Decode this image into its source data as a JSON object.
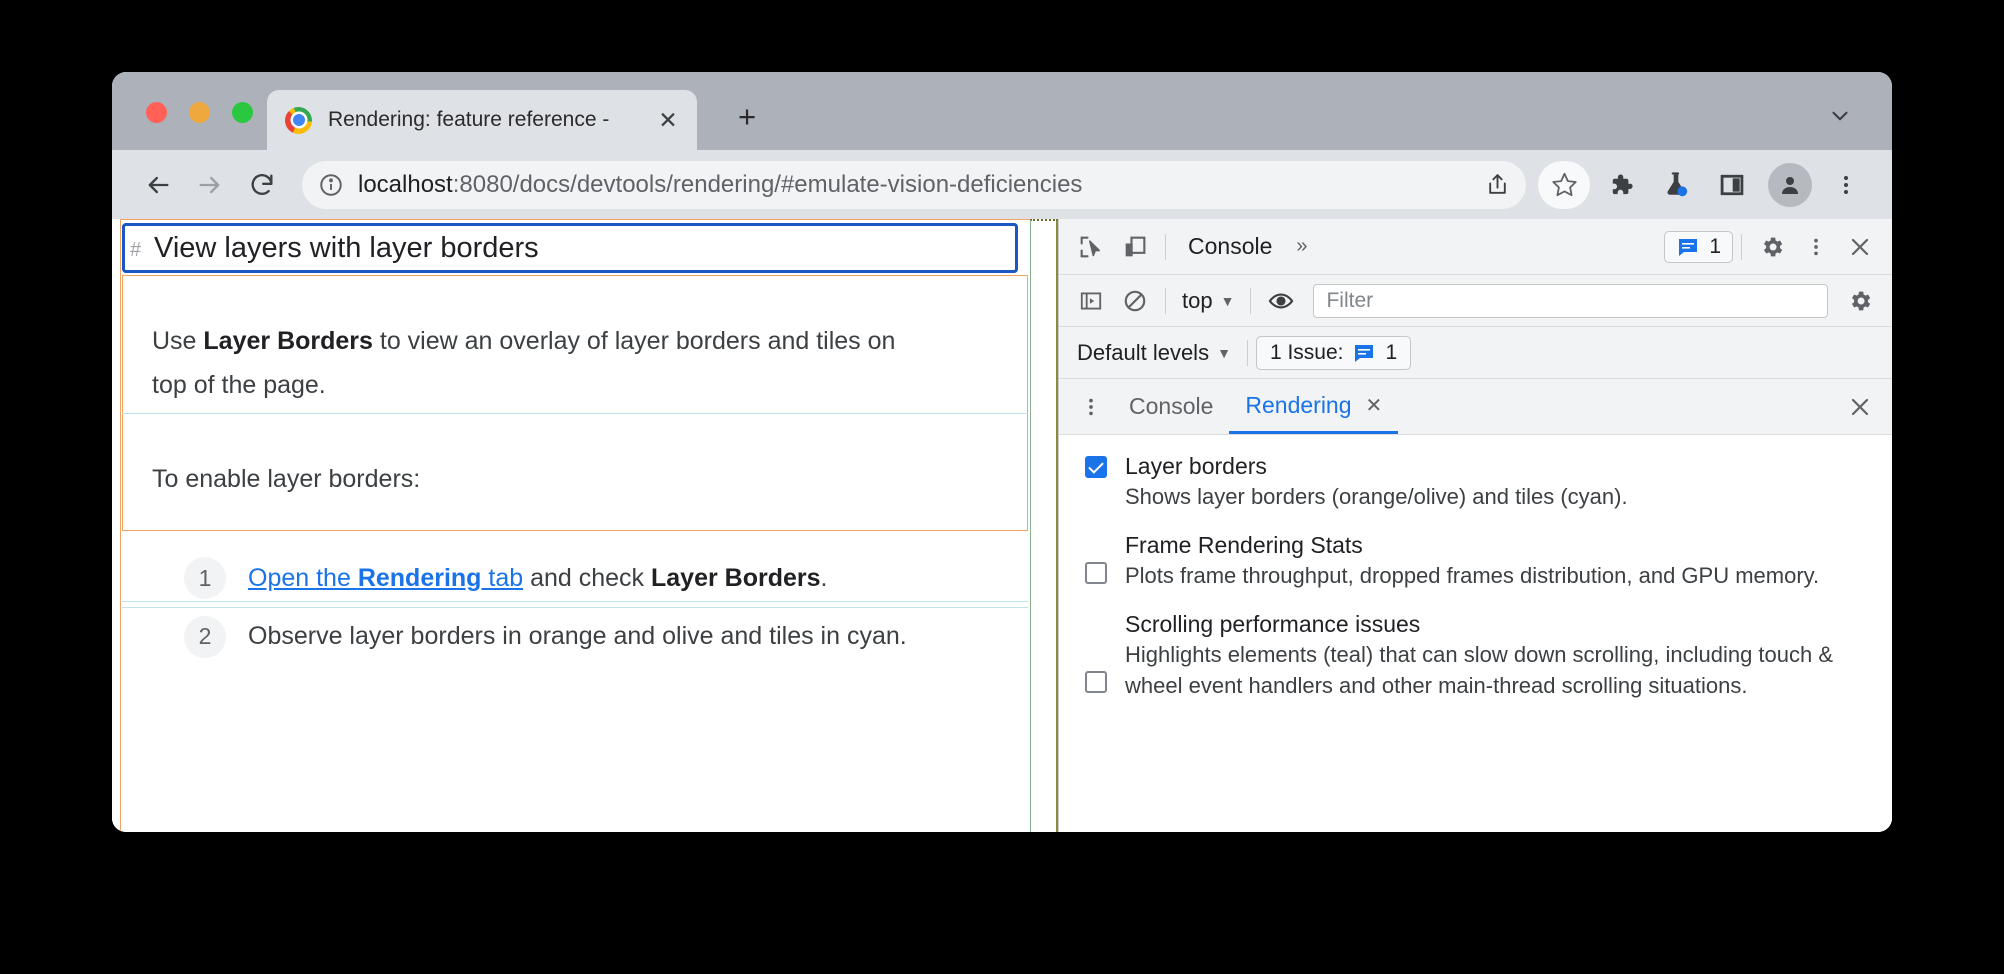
{
  "browser": {
    "tab": {
      "title": "Rendering: feature reference - ",
      "close_label": "✕"
    },
    "newtab_label": "+",
    "omnibox": {
      "url_host": "localhost",
      "url_rest": ":8080/docs/devtools/rendering/#emulate-vision-deficiencies"
    },
    "icons": {
      "back": "back-arrow-icon",
      "forward": "forward-arrow-icon",
      "reload": "reload-icon",
      "site_info": "info-circle-icon",
      "share": "share-icon",
      "bookmark": "star-icon",
      "extensions": "puzzle-piece-icon",
      "experiments": "flask-icon",
      "side_panel": "side-panel-icon",
      "profile": "avatar-icon",
      "menu": "three-dot-menu-icon",
      "tab_list": "chevron-down-icon"
    }
  },
  "page": {
    "anchor": "#",
    "heading": "View layers with layer borders",
    "paragraph1_pre": "Use ",
    "paragraph1_bold": "Layer Borders",
    "paragraph1_post": " to view an overlay of layer borders and tiles on",
    "paragraph1_line2": "top of the page.",
    "paragraph2": "To enable layer borders:",
    "steps": [
      {
        "num": "1",
        "link_pre": "Open the ",
        "link_bold": "Rendering",
        "link_post": " tab",
        "mid": " and check ",
        "bold": "Layer Borders",
        "end": "."
      },
      {
        "num": "2",
        "text": "Observe layer borders in orange and olive and tiles in cyan."
      }
    ],
    "overlay_colors": {
      "layer_border_orange": "#f4a460",
      "layer_border_olive": "#8a8a45",
      "tile_cyan": "#bfe3e8",
      "selected_layer_blue": "#1a56c4"
    }
  },
  "devtools": {
    "main_toolbar": {
      "inspect_icon": "inspect-cursor-icon",
      "device_icon": "device-toolbar-icon",
      "active_tab": "Console",
      "more_tabs": "»",
      "issues_count": "1",
      "issues_icon": "message-bubble-icon",
      "settings_icon": "gear-icon",
      "more_icon": "three-dot-menu-icon",
      "close_icon": "close-icon"
    },
    "console_toolbar": {
      "sidebar_icon": "console-sidebar-icon",
      "clear_icon": "clear-console-icon",
      "context": "top",
      "eye_icon": "eye-icon",
      "filter_placeholder": "Filter",
      "settings_icon": "gear-icon"
    },
    "levels_row": {
      "levels": "Default levels",
      "issue_label": "1 Issue:",
      "issue_count": "1",
      "issue_icon": "message-bubble-icon"
    },
    "drawer": {
      "menu_icon": "three-dot-menu-icon",
      "tabs": [
        {
          "label": "Console",
          "active": false,
          "closable": false
        },
        {
          "label": "Rendering",
          "active": true,
          "closable": true,
          "close_label": "✕"
        }
      ],
      "close_icon": "close-icon",
      "close_label": "✕"
    },
    "rendering_options": [
      {
        "title": "Layer borders",
        "description": "Shows layer borders (orange/olive) and tiles (cyan).",
        "checked": true
      },
      {
        "title": "Frame Rendering Stats",
        "description": "Plots frame throughput, dropped frames distribution, and GPU memory.",
        "checked": false
      },
      {
        "title": "Scrolling performance issues",
        "description": "Highlights elements (teal) that can slow down scrolling, including touch & wheel event handlers and other main-thread scrolling situations.",
        "checked": false
      }
    ]
  }
}
